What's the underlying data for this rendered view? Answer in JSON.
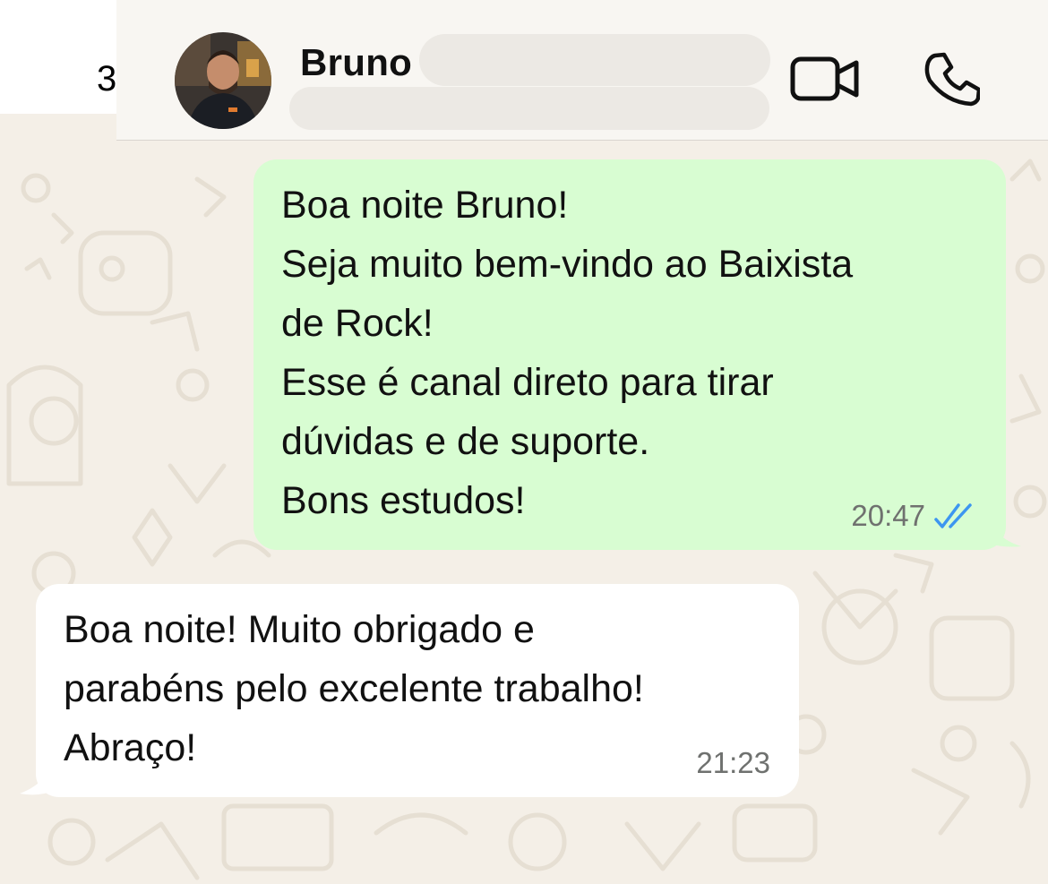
{
  "header": {
    "back_glyph": "3",
    "contact_name": "Bruno",
    "avatar_alt": "contact-photo"
  },
  "icons": {
    "video": "video-camera-icon",
    "call": "phone-icon",
    "read_receipt": "double-check-icon"
  },
  "colors": {
    "outgoing_bubble": "#d8fdd2",
    "incoming_bubble": "#ffffff",
    "wallpaper": "#f4efe7",
    "read_tick": "#3d96f0"
  },
  "messages": [
    {
      "direction": "outgoing",
      "lines": [
        "Boa noite Bruno!",
        "Seja muito bem-vindo ao Baixista",
        "de Rock!",
        "Esse é canal direto para tirar",
        "dúvidas e de suporte.",
        "Bons estudos!"
      ],
      "time": "20:47",
      "status": "read"
    },
    {
      "direction": "incoming",
      "lines": [
        "Boa noite! Muito obrigado e",
        "parabéns pelo excelente trabalho!",
        "Abraço!"
      ],
      "time": "21:23"
    }
  ]
}
